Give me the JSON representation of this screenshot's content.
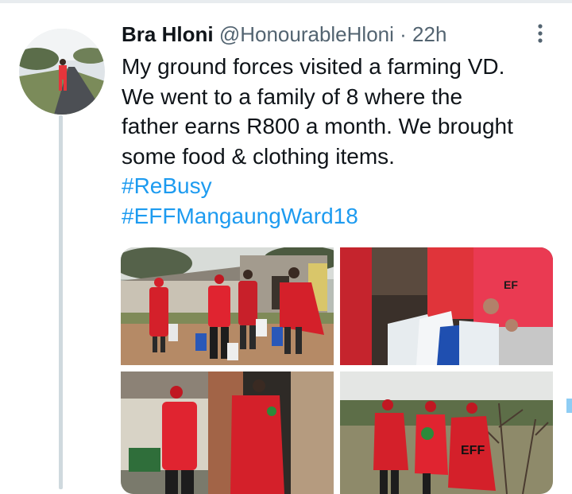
{
  "tweet": {
    "display_name": "Bra Hloni",
    "handle": "@HonourableHloni",
    "separator": "·",
    "timestamp": "22h",
    "text_lines": [
      "My ground forces visited a farming VD.",
      "We went to a family of 8 where the",
      "father earns R800 a month. We brought",
      "some food & clothing items."
    ],
    "hashtags": [
      "#ReBusy",
      "#EFFMangaungWard18"
    ],
    "more_icon": "more-vertical-icon"
  },
  "media": {
    "photos": [
      {
        "alt_name": "photo-volunteers-walking-with-bags"
      },
      {
        "alt_name": "photo-food-parcels-closeup"
      },
      {
        "alt_name": "photo-volunteers-at-house-door"
      },
      {
        "alt_name": "photo-volunteers-in-field"
      }
    ],
    "badge_text": "EFF"
  },
  "colors": {
    "hashtag": "#1d9bf0",
    "secondary_text": "#536471",
    "thread_line": "#cfd9de",
    "eff_red": "#d4202a"
  }
}
